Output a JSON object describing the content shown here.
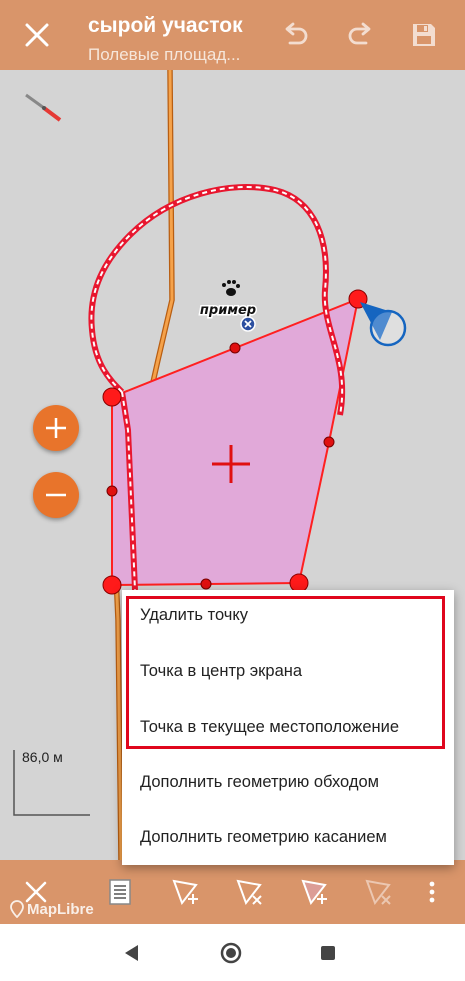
{
  "header": {
    "title": "сырой участок",
    "subtitle": "Полевые площад...",
    "close_icon": "close-icon",
    "undo_icon": "undo-icon",
    "redo_icon": "redo-icon",
    "save_icon": "save-icon"
  },
  "map": {
    "point_label": "пример",
    "scale_label": "86,0 м",
    "attribution": "MapLibre",
    "zoom_in_icon": "plus-icon",
    "zoom_out_icon": "minus-icon"
  },
  "context_menu": {
    "items": [
      "Удалить точку",
      "Точка в центр экрана",
      "Точка в текущее местоположение",
      "Дополнить геометрию обходом",
      "Дополнить геометрию касанием"
    ]
  },
  "toolbar": {
    "tools": [
      "close-icon",
      "list-icon",
      "add-vertex-icon",
      "delete-vertex-icon",
      "add-point-icon",
      "remove-point-icon",
      "more-icon"
    ]
  },
  "colors": {
    "accent": "#d9956a",
    "polygon_fill": "#e1a9d9",
    "polygon_stroke": "#ff2020",
    "highlight": "#e0061d",
    "zoom_button": "#e8742b"
  }
}
